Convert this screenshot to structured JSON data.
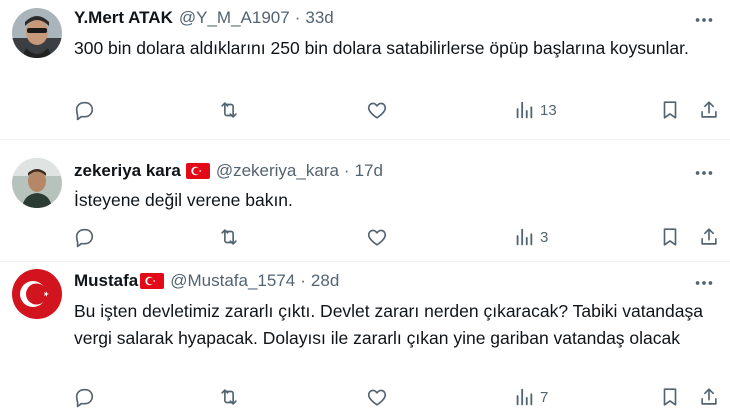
{
  "tweets": [
    {
      "name": "Y.Mert ATAK",
      "handle": "@Y_M_A1907",
      "separator": "·",
      "time": "33d",
      "text": "300 bin dolara aldıklarını 250 bin dolara satabilirlerse öpüp başlarına koysunlar.",
      "flag": false,
      "views": "13"
    },
    {
      "name": "zekeriya kara",
      "handle": "@zekeriya_kara",
      "separator": "·",
      "time": "17d",
      "text": "İsteyene değil verene bakın.",
      "flag": true,
      "views": "3"
    },
    {
      "name": "Mustafa",
      "handle": "@Mustafa_1574",
      "separator": "·",
      "time": "28d",
      "text": "Bu işten devletimiz zararlı çıktı. Devlet zararı nerden çıkaracak? Tabiki vatandaşa vergi salarak hyapacak. Dolayısı ile zararlı çıkan yine gariban vatandaş olacak",
      "flag": true,
      "views": "7"
    }
  ],
  "colors": {
    "text": "#0f1419",
    "secondary": "#536471",
    "divider": "#eff3f4",
    "flag_red": "#e30a17"
  },
  "icons": [
    "reply-icon",
    "retweet-icon",
    "like-icon",
    "views-icon",
    "bookmark-icon",
    "share-icon",
    "more-icon",
    "turkey-flag-icon"
  ]
}
